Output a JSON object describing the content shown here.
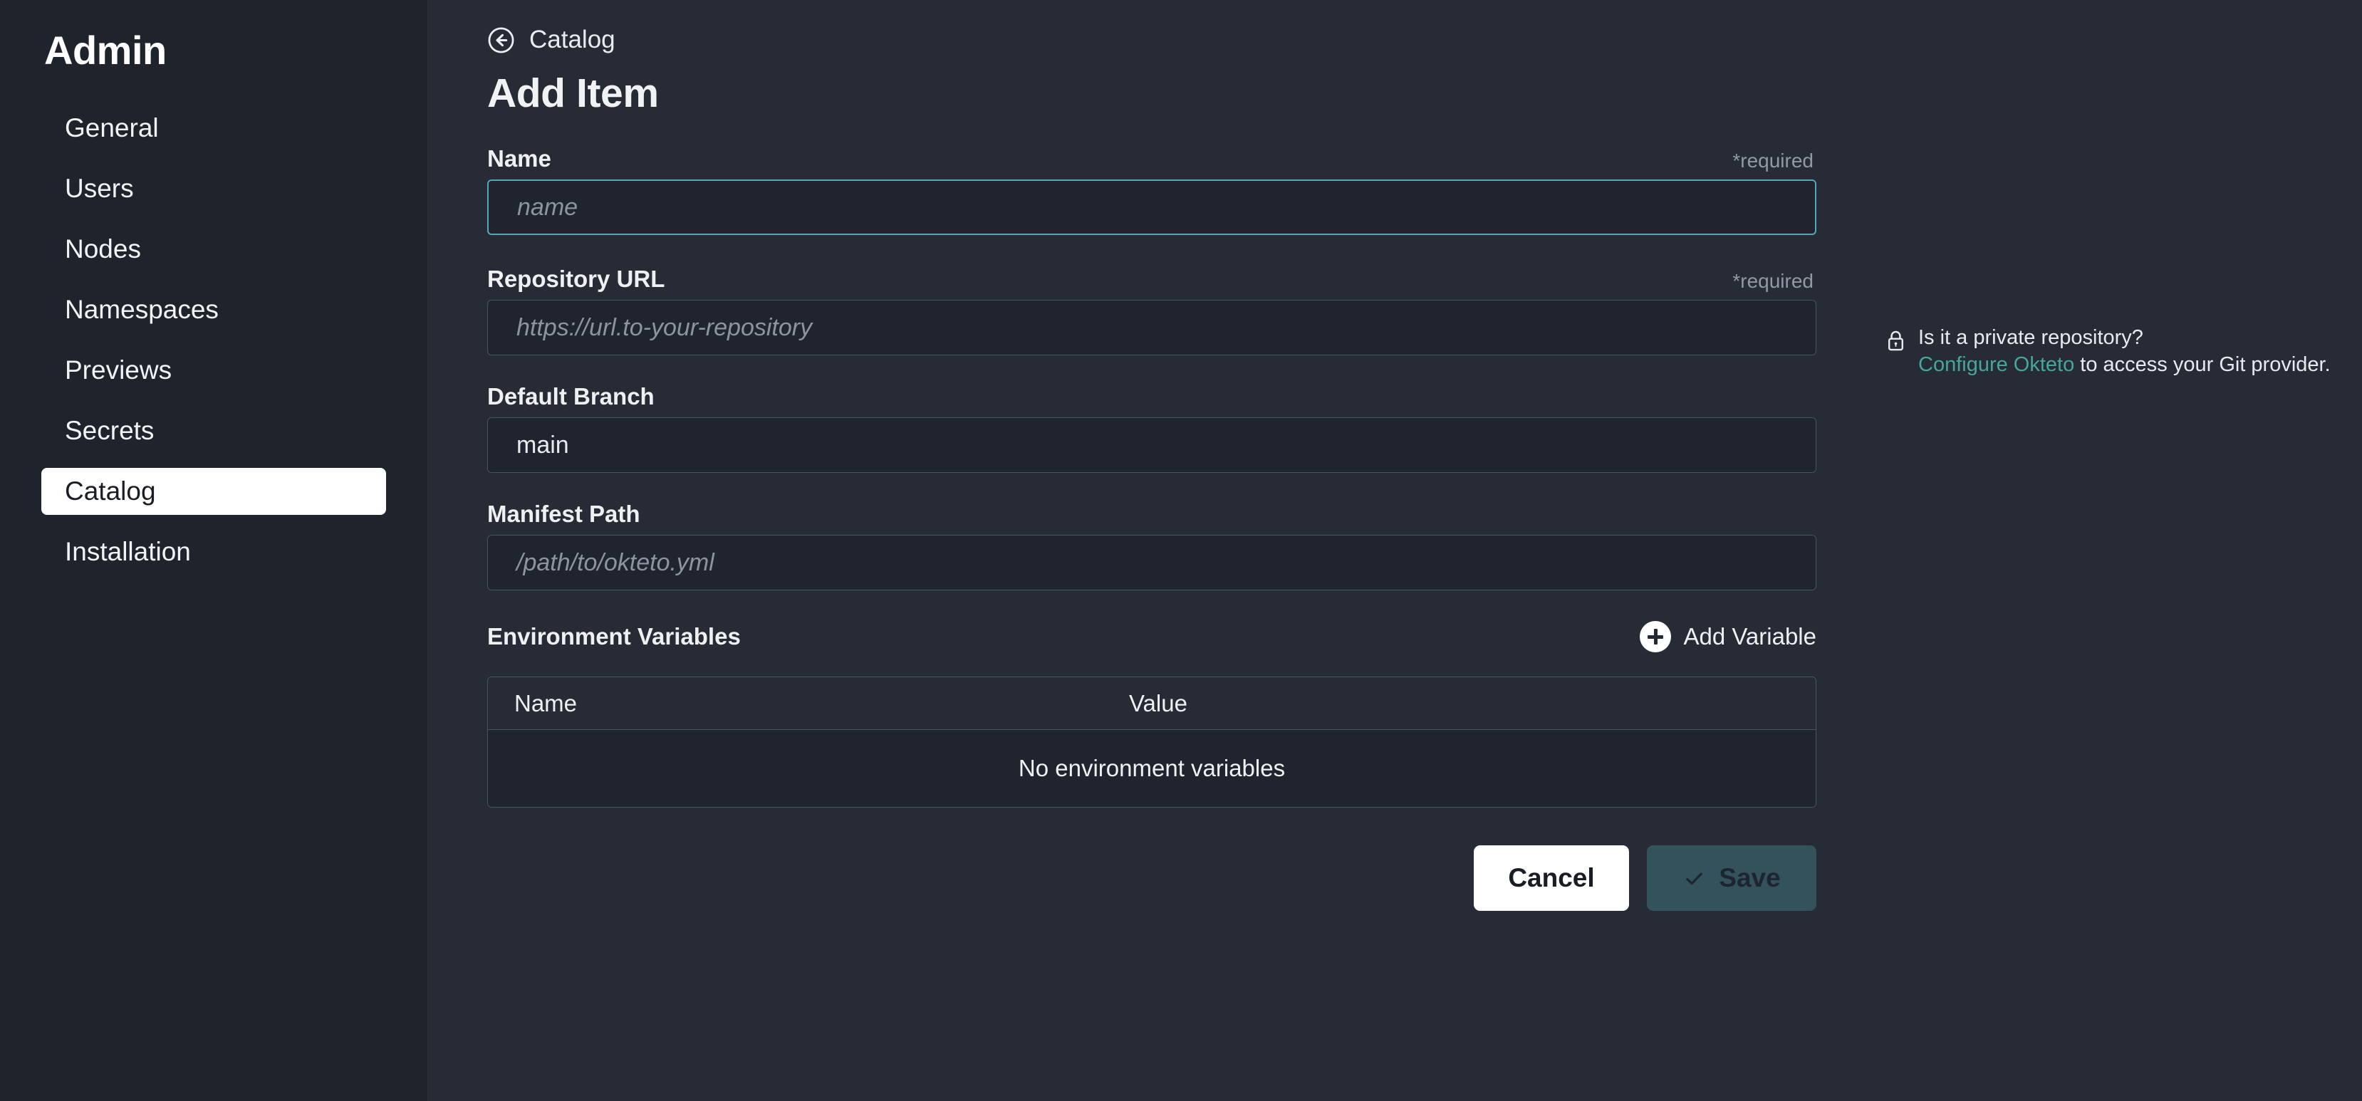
{
  "sidebar": {
    "title": "Admin",
    "items": [
      {
        "label": "General",
        "active": false
      },
      {
        "label": "Users",
        "active": false
      },
      {
        "label": "Nodes",
        "active": false
      },
      {
        "label": "Namespaces",
        "active": false
      },
      {
        "label": "Previews",
        "active": false
      },
      {
        "label": "Secrets",
        "active": false
      },
      {
        "label": "Catalog",
        "active": true
      },
      {
        "label": "Installation",
        "active": false
      }
    ]
  },
  "header": {
    "breadcrumb": "Catalog",
    "back_icon": "circle-arrow-left-icon",
    "title": "Add Item"
  },
  "form": {
    "name": {
      "label": "Name",
      "required_tag": "*required",
      "value": "",
      "placeholder": "name",
      "focused": true
    },
    "repository_url": {
      "label": "Repository URL",
      "required_tag": "*required",
      "value": "",
      "placeholder": "https://url.to-your-repository",
      "focused": false
    },
    "default_branch": {
      "label": "Default Branch",
      "required_tag": "",
      "value": "main",
      "placeholder": "",
      "focused": false
    },
    "manifest_path": {
      "label": "Manifest Path",
      "required_tag": "",
      "value": "",
      "placeholder": "/path/to/okteto.yml",
      "focused": false
    }
  },
  "side_note": {
    "lock_icon": "lock-icon",
    "question": "Is it a private repository?",
    "link_text": "Configure Okteto",
    "rest_text": " to access your Git provider."
  },
  "env_vars": {
    "title": "Environment Variables",
    "add_button_label": "Add Variable",
    "add_button_icon": "plus-circle-icon",
    "columns": [
      "Name",
      "Value"
    ],
    "rows": [],
    "empty_message": "No environment variables"
  },
  "actions": {
    "cancel_label": "Cancel",
    "save_label": "Save",
    "save_icon": "check-icon",
    "save_disabled": true
  },
  "colors": {
    "sidebar_bg": "#1f232c",
    "main_bg": "#262b36",
    "input_bg": "#20242e",
    "input_border": "#4b525f",
    "focus_border": "#55a8bb",
    "link_teal": "#45a699",
    "save_bg": "#34525c",
    "active_nav_bg": "#ffffff"
  }
}
